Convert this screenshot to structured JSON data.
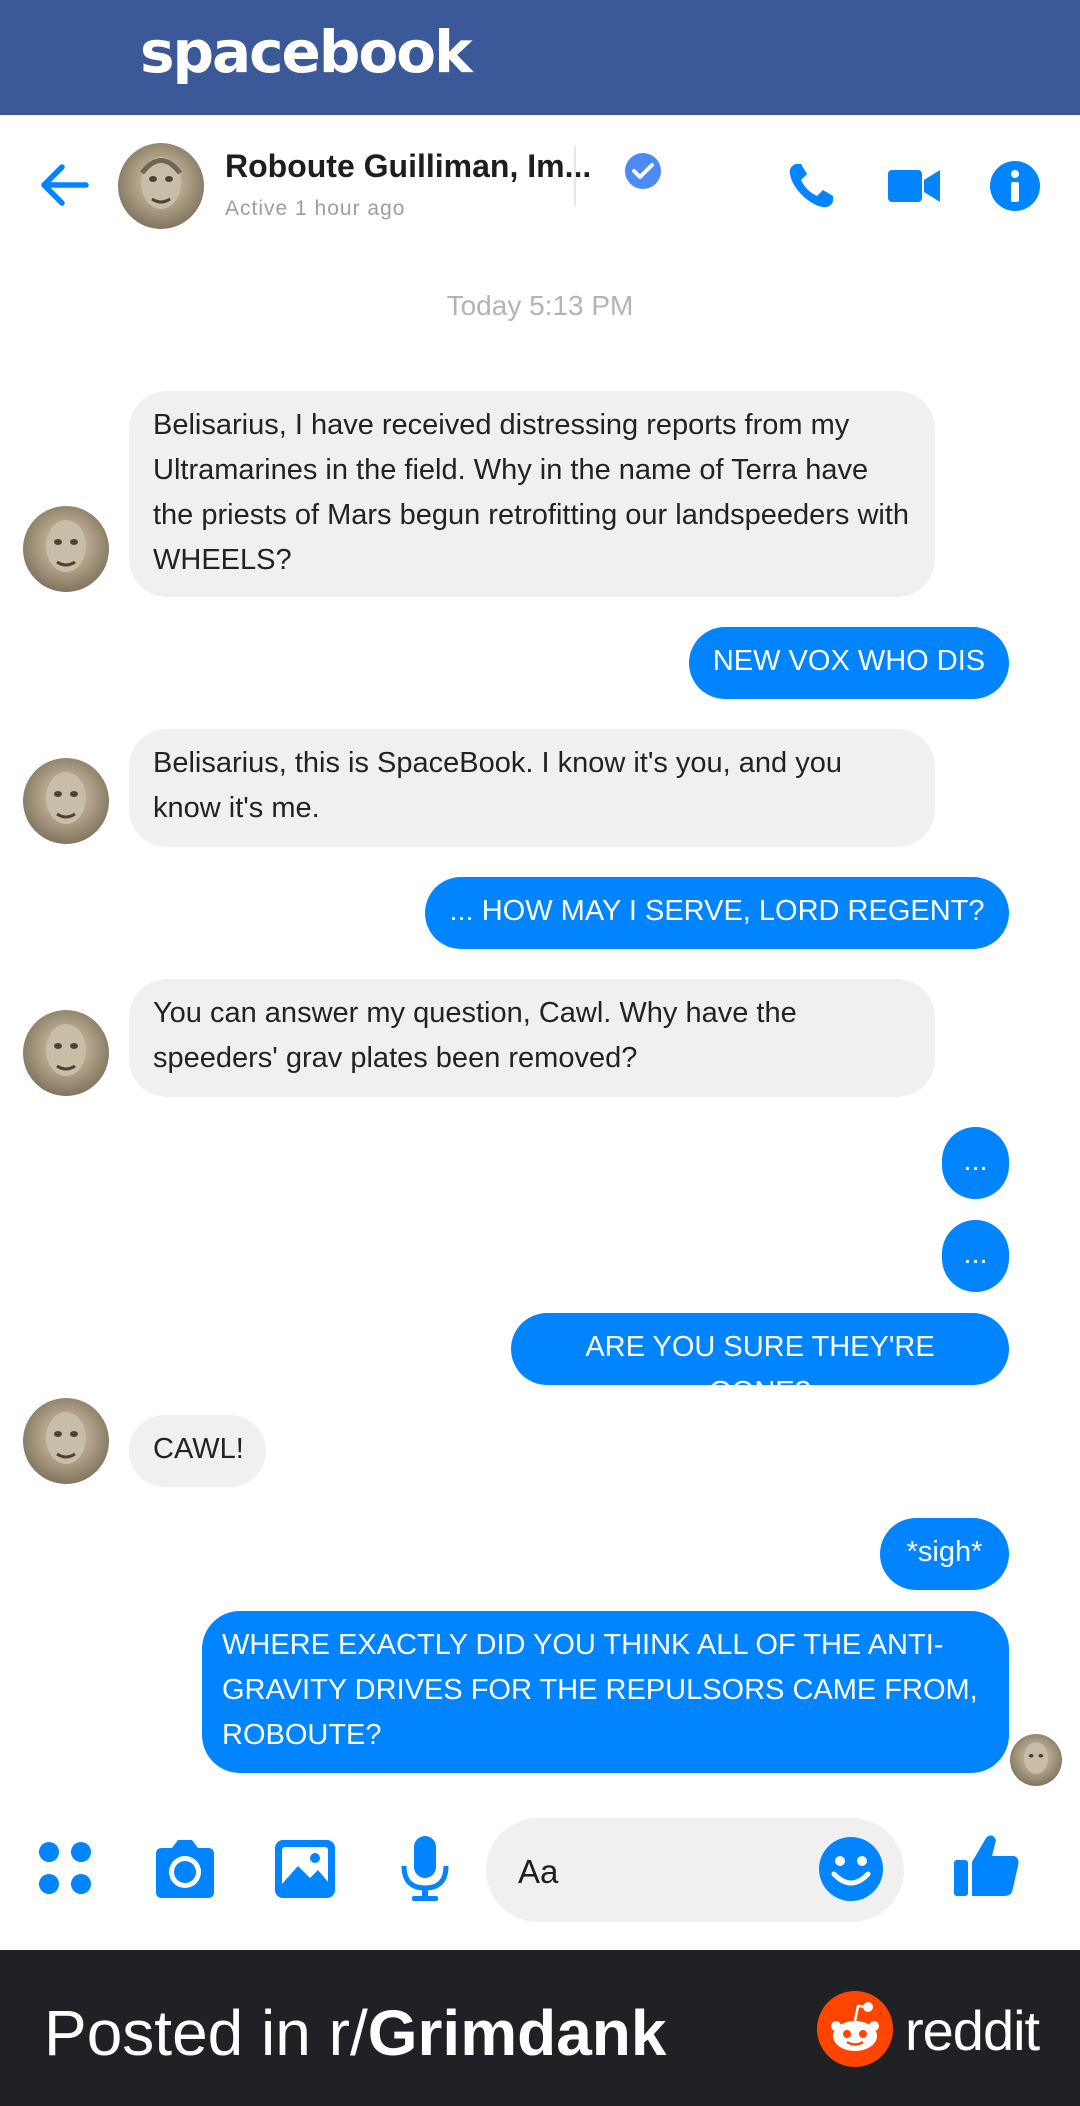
{
  "app": {
    "brand": "spacebook"
  },
  "header": {
    "contact_name": "Roboute Guilliman, Im...",
    "status": "Active 1 hour ago",
    "icons": [
      "back-arrow-icon",
      "verified-check-icon",
      "phone-icon",
      "video-camera-icon",
      "info-icon"
    ]
  },
  "conversation": {
    "timestamp": "Today 5:13 PM",
    "messages": [
      {
        "from": "them",
        "text": "Belisarius, I have received distressing reports from my Ultramarines in the field. Why in the name of Terra have the priests of Mars begun retrofitting our landspeeders with WHEELS?"
      },
      {
        "from": "me",
        "text": "NEW VOX WHO DIS"
      },
      {
        "from": "them",
        "text": "Belisarius, this is SpaceBook. I know it's you, and you know it's me."
      },
      {
        "from": "me",
        "text": "... HOW MAY I SERVE, LORD REGENT?"
      },
      {
        "from": "them",
        "text": "You can answer my question, Cawl. Why have the speeders' grav plates been removed?"
      },
      {
        "from": "me",
        "text": "..."
      },
      {
        "from": "me",
        "text": "..."
      },
      {
        "from": "me",
        "text": "ARE YOU SURE THEY'RE GONE?"
      },
      {
        "from": "them",
        "text": "CAWL!"
      },
      {
        "from": "me",
        "text": "*sigh*"
      },
      {
        "from": "me",
        "text": "WHERE EXACTLY DID YOU THINK ALL OF THE ANTI-GRAVITY DRIVES FOR THE REPULSORS CAME FROM, ROBOUTE?"
      }
    ]
  },
  "composer": {
    "placeholder": "Aa",
    "icons": [
      "apps-grid-icon",
      "camera-icon",
      "gallery-image-icon",
      "microphone-icon",
      "emoji-icon",
      "thumbs-up-icon"
    ]
  },
  "footer": {
    "prefix": "Posted in r/",
    "subreddit": "Grimdank",
    "reddit_word": "reddit"
  },
  "colors": {
    "brand_bar": "#3b5998",
    "accent": "#0084ff",
    "incoming_bubble": "#f1f0f0",
    "footer": "#202124",
    "reddit_orange": "#ff4500"
  }
}
